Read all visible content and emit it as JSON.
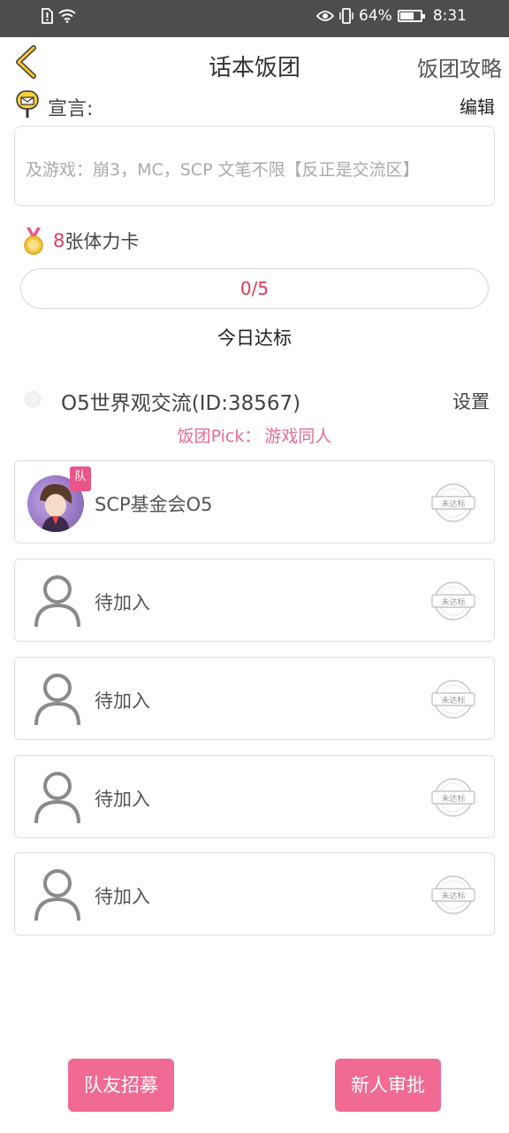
{
  "status_bar": {
    "battery_percent": "64%",
    "battery_level": 0.64,
    "time": "8:31"
  },
  "header": {
    "title": "话本饭团",
    "guide_link": "饭团攻略"
  },
  "declaration": {
    "label": "宣言:",
    "edit_label": "编辑",
    "text": "及游戏：崩3，MC，SCP 文笔不限【反正是交流区】"
  },
  "stamina": {
    "count": "8",
    "label": "张体力卡"
  },
  "progress": {
    "text": "0/5",
    "value": 0,
    "max": 5
  },
  "daily_label": "今日达标",
  "group": {
    "name": "O5世界观交流(ID:38567)",
    "settings_label": "设置",
    "pick_label": "饭团Pick：",
    "pick_value": "游戏同人"
  },
  "members": [
    {
      "name": "SCP基金会O5",
      "status": "未达标",
      "badge": "队"
    },
    {
      "name": "待加入",
      "status": "未达标"
    },
    {
      "name": "待加入",
      "status": "未达标"
    },
    {
      "name": "待加入",
      "status": "未达标"
    },
    {
      "name": "待加入",
      "status": "未达标"
    }
  ],
  "buttons": {
    "recruit": "队友招募",
    "approve": "新人审批"
  },
  "colors": {
    "accent_pink": "#f06a93",
    "count_red": "#e03a5a",
    "status_bar": "#4d4d4d"
  }
}
